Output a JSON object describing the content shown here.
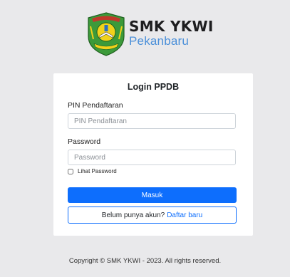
{
  "brand": {
    "name": "SMK YKWI",
    "city": "Pekanbaru",
    "logo_icon": "school-crest-icon",
    "colors": {
      "name": "#1d1d1f",
      "city": "#4a8fd9",
      "crest_green": "#3c9a3a",
      "crest_yellow": "#f2d21b"
    }
  },
  "login": {
    "title": "Login PPDB",
    "pin_label": "PIN Pendaftaran",
    "pin_placeholder": "PIN Pendaftaran",
    "pin_value": "",
    "password_label": "Password",
    "password_placeholder": "Password",
    "password_value": "",
    "show_password_label": "Lihat Password",
    "show_password_checked": false,
    "submit_label": "Masuk",
    "register_prompt": "Belum punya akun?",
    "register_link": "Daftar baru"
  },
  "footer": {
    "text": "Copyright © SMK YKWI - 2023. All rights reserved."
  },
  "colors": {
    "primary": "#0d6efd",
    "background": "#e9e9eb",
    "card": "#ffffff"
  }
}
